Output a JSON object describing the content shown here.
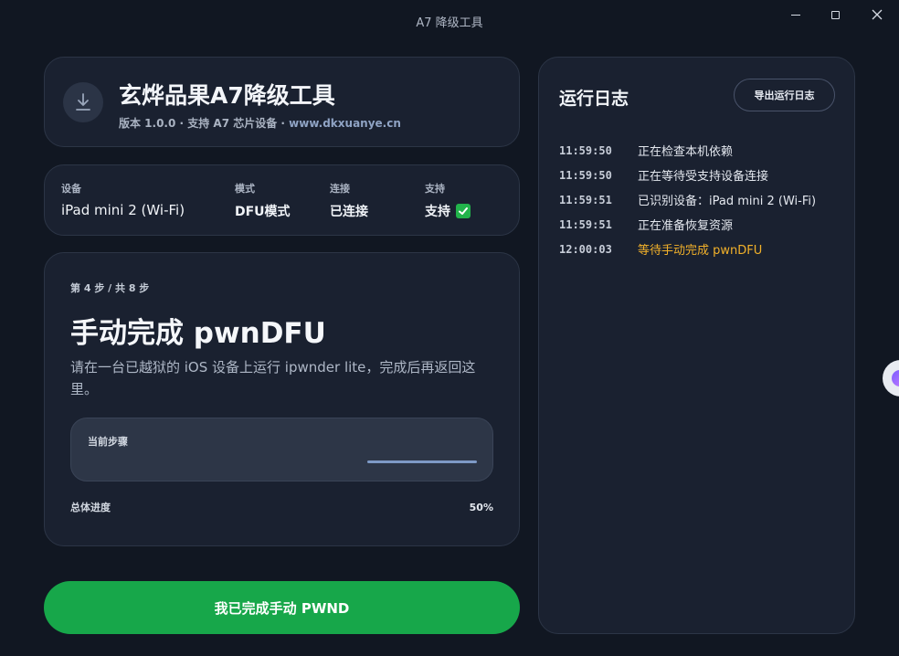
{
  "window": {
    "title": "A7 降级工具",
    "controls": {
      "minimize": "minimize-icon",
      "maximize": "maximize-icon",
      "close": "close-icon"
    }
  },
  "header": {
    "icon": "download-icon",
    "title": "玄烨品果A7降级工具",
    "subtitle_prefix": "版本 1.0.0 · 支持 A7 芯片设备 · ",
    "subtitle_link": "www.dkxuanye.cn"
  },
  "device": {
    "device_label": "设备",
    "device_value": "iPad mini 2 (Wi-Fi)",
    "mode_label": "模式",
    "mode_value": "DFU模式",
    "connection_label": "连接",
    "connection_value": "已连接",
    "support_label": "支持",
    "support_value": "支持",
    "support_icon": "check-icon"
  },
  "step": {
    "count": "第 4 步 / 共 8 步",
    "title": "手动完成 pwnDFU",
    "description": "请在一台已越狱的 iOS 设备上运行 ipwnder lite，完成后再返回这里。",
    "current_label": "当前步骤",
    "current_progress": 1.0,
    "overall_label": "总体进度",
    "overall_percent": "50%"
  },
  "actions": {
    "done_label": "我已完成手动 PWND"
  },
  "log": {
    "title": "运行日志",
    "export_label": "导出运行日志",
    "entries": [
      {
        "time": "11:59:50",
        "message": "正在检查本机依赖",
        "level": "info"
      },
      {
        "time": "11:59:50",
        "message": "正在等待受支持设备连接",
        "level": "info"
      },
      {
        "time": "11:59:51",
        "message": "已识别设备：iPad mini 2 (Wi-Fi)",
        "level": "info"
      },
      {
        "time": "11:59:51",
        "message": "正在准备恢复资源",
        "level": "info"
      },
      {
        "time": "12:00:03",
        "message": "等待手动完成 pwnDFU",
        "level": "warn"
      }
    ]
  },
  "colors": {
    "background": "#111722",
    "card": "#1a2130",
    "accent_green": "#17a74a",
    "warning": "#f2b12a",
    "progress": "#7e9ac6"
  }
}
